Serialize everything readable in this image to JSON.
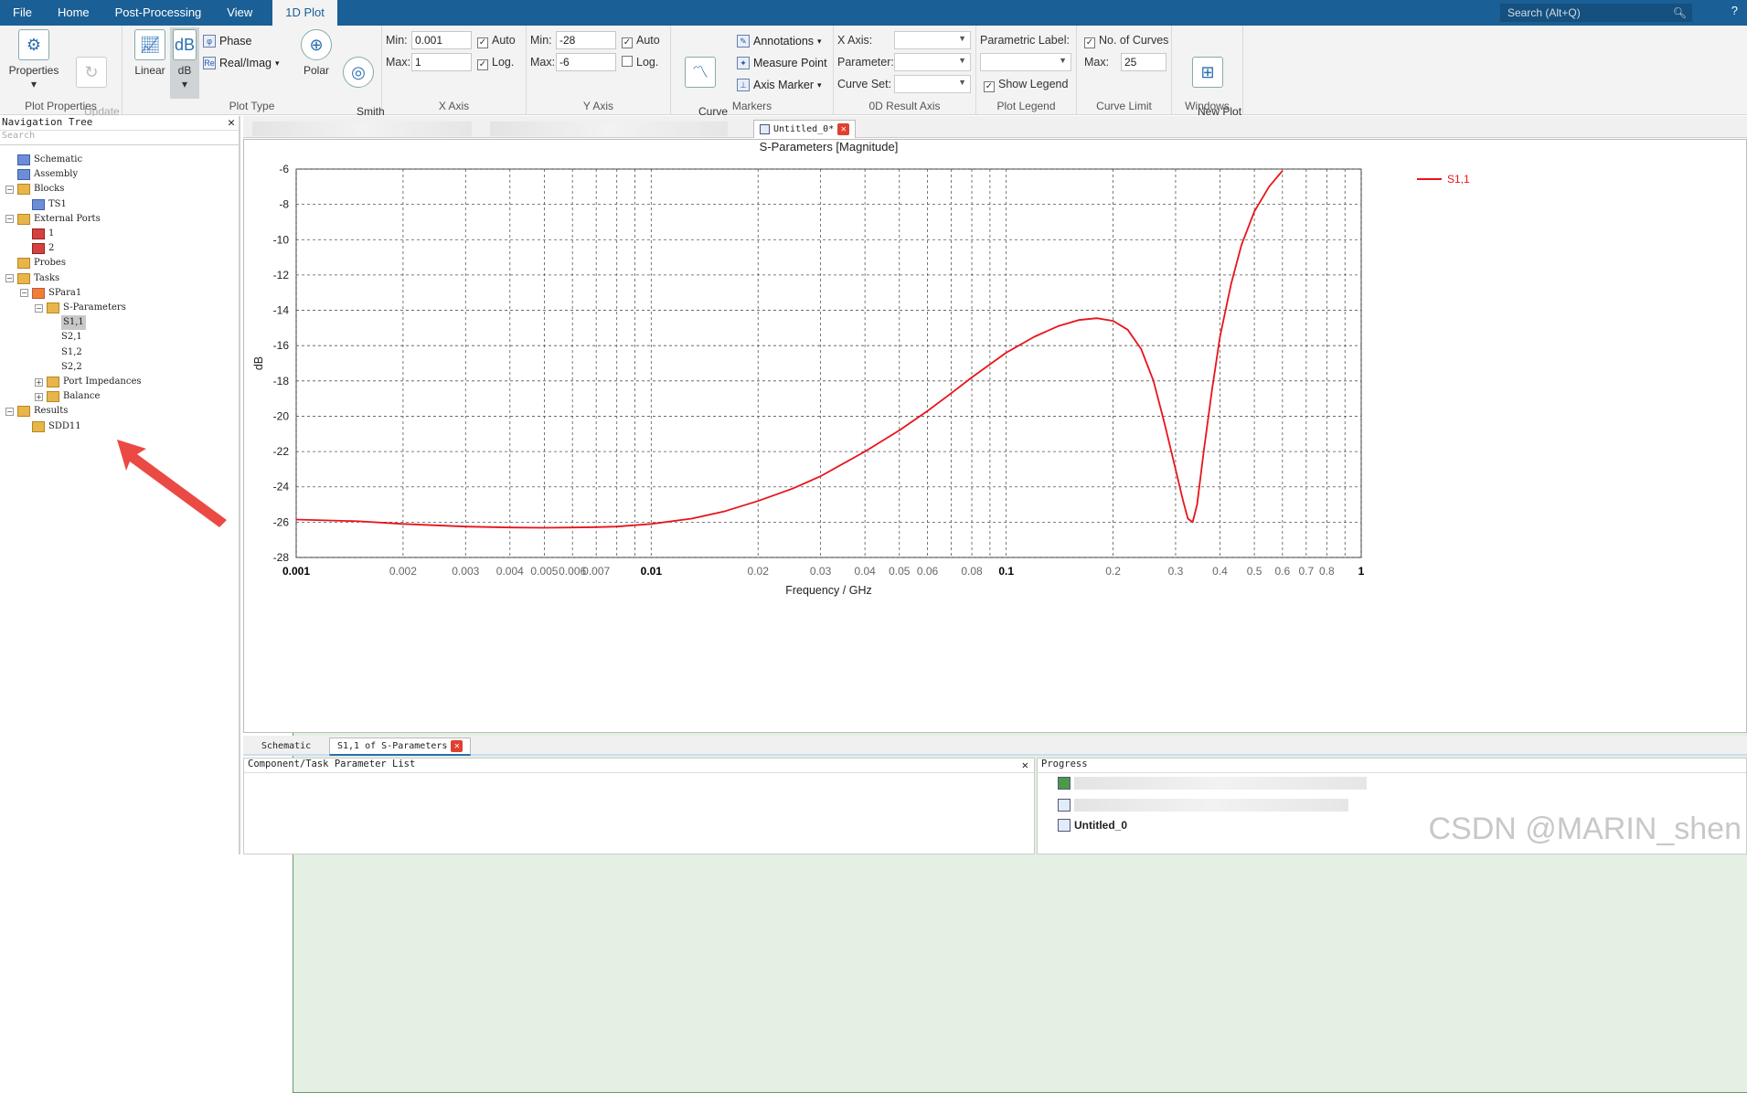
{
  "menu": {
    "items": [
      "File",
      "Home",
      "Post-Processing",
      "View",
      "1D Plot"
    ],
    "active": "1D Plot",
    "search_placeholder": "Search (Alt+Q)"
  },
  "ribbon": {
    "plot_properties": {
      "label": "Plot Properties",
      "properties": "Properties",
      "update": "Update\nResults"
    },
    "plot_type": {
      "label": "Plot Type",
      "linear": "Linear",
      "db": "dB",
      "phase": "Phase",
      "realimag": "Real/Imag",
      "polar": "Polar",
      "smith": "Smith\nChart"
    },
    "x_axis": {
      "label": "X Axis",
      "min_label": "Min:",
      "min": "0.001",
      "max_label": "Max:",
      "max": "1",
      "auto": "Auto",
      "auto_checked": true,
      "log": "Log.",
      "log_checked": true
    },
    "y_axis": {
      "label": "Y Axis",
      "min_label": "Min:",
      "min": "-28",
      "max_label": "Max:",
      "max": "-6",
      "auto": "Auto",
      "auto_checked": true,
      "log": "Log.",
      "log_checked": false
    },
    "markers": {
      "label": "Markers",
      "curve_markers": "Curve\nMarkers",
      "annotations": "Annotations",
      "measure_point": "Measure Point",
      "axis_marker": "Axis Marker"
    },
    "result0d": {
      "label": "0D Result Axis",
      "x_axis": "X Axis:",
      "parameter": "Parameter:",
      "curve_set": "Curve Set:"
    },
    "plot_legend": {
      "label": "Plot Legend",
      "parametric_label": "Parametric Label:",
      "show_legend": "Show Legend",
      "show_checked": true
    },
    "curve_limit": {
      "label": "Curve Limit",
      "no_curves": "No. of Curves",
      "no_checked": true,
      "max_label": "Max:",
      "max": "25"
    },
    "windows": {
      "label": "Windows",
      "new_plot": "New Plot\nWindow"
    }
  },
  "nav": {
    "title": "Navigation Tree",
    "search_placeholder": "Search",
    "items": [
      {
        "label": "Schematic",
        "icon": "schematic-icon",
        "level": 0
      },
      {
        "label": "Assembly",
        "icon": "assembly-icon",
        "level": 0
      },
      {
        "label": "Blocks",
        "icon": "folder-icon",
        "level": 0,
        "exp": "−"
      },
      {
        "label": "TS1",
        "icon": "block-icon",
        "level": 1
      },
      {
        "label": "External Ports",
        "icon": "folder-icon",
        "level": 0,
        "exp": "−"
      },
      {
        "label": "1",
        "icon": "port-icon",
        "level": 1
      },
      {
        "label": "2",
        "icon": "port-icon",
        "level": 1
      },
      {
        "label": "Probes",
        "icon": "folder-icon",
        "level": 0
      },
      {
        "label": "Tasks",
        "icon": "folder-icon",
        "level": 0,
        "exp": "−"
      },
      {
        "label": "SPara1",
        "icon": "task-icon",
        "level": 1,
        "exp": "−"
      },
      {
        "label": "S-Parameters",
        "icon": "folder-icon",
        "level": 2,
        "exp": "−"
      },
      {
        "label": "S1,1",
        "icon": "plot-icon",
        "level": 3,
        "selected": true
      },
      {
        "label": "S2,1",
        "icon": "plot-icon",
        "level": 3
      },
      {
        "label": "S1,2",
        "icon": "plot-icon",
        "level": 3
      },
      {
        "label": "S2,2",
        "icon": "plot-icon",
        "level": 3
      },
      {
        "label": "Port Impedances",
        "icon": "folder-icon",
        "level": 2,
        "exp": "+"
      },
      {
        "label": "Balance",
        "icon": "folder-icon",
        "level": 2,
        "exp": "+"
      },
      {
        "label": "Results",
        "icon": "folder-icon",
        "level": 0,
        "exp": "−"
      },
      {
        "label": "SDD11",
        "icon": "folder-icon",
        "level": 1
      }
    ]
  },
  "doc_tabs": {
    "active": "Untitled_0*"
  },
  "chart_data": {
    "type": "line",
    "title": "S-Parameters [Magnitude]",
    "xlabel": "Frequency / GHz",
    "ylabel": "dB",
    "xscale": "log",
    "xlim": [
      0.001,
      1
    ],
    "ylim": [
      -28,
      -6
    ],
    "grid": true,
    "legend": "top-right",
    "y_ticks": [
      -6,
      -8,
      -10,
      -12,
      -14,
      -16,
      -18,
      -20,
      -22,
      -24,
      -26,
      -28
    ],
    "x_ticks": [
      {
        "v": 0.001,
        "l": "0.001",
        "major": true
      },
      {
        "v": 0.002,
        "l": "0.002"
      },
      {
        "v": 0.003,
        "l": "0.003"
      },
      {
        "v": 0.004,
        "l": "0.004"
      },
      {
        "v": 0.005,
        "l": "0.005"
      },
      {
        "v": 0.006,
        "l": "0.006"
      },
      {
        "v": 0.007,
        "l": "0.007"
      },
      {
        "v": 0.008,
        "l": ""
      },
      {
        "v": 0.009,
        "l": ""
      },
      {
        "v": 0.01,
        "l": "0.01",
        "major": true
      },
      {
        "v": 0.02,
        "l": "0.02"
      },
      {
        "v": 0.03,
        "l": "0.03"
      },
      {
        "v": 0.04,
        "l": "0.04"
      },
      {
        "v": 0.05,
        "l": "0.05"
      },
      {
        "v": 0.06,
        "l": "0.06"
      },
      {
        "v": 0.07,
        "l": ""
      },
      {
        "v": 0.08,
        "l": "0.08"
      },
      {
        "v": 0.09,
        "l": ""
      },
      {
        "v": 0.1,
        "l": "0.1",
        "major": true
      },
      {
        "v": 0.2,
        "l": "0.2"
      },
      {
        "v": 0.3,
        "l": "0.3"
      },
      {
        "v": 0.4,
        "l": "0.4"
      },
      {
        "v": 0.5,
        "l": "0.5"
      },
      {
        "v": 0.6,
        "l": "0.6"
      },
      {
        "v": 0.7,
        "l": "0.7"
      },
      {
        "v": 0.8,
        "l": "0.8"
      },
      {
        "v": 0.9,
        "l": ""
      },
      {
        "v": 1,
        "l": "1",
        "major": true
      }
    ],
    "series": [
      {
        "name": "S1,1",
        "color": "#e8141a",
        "x": [
          0.001,
          0.0015,
          0.002,
          0.003,
          0.004,
          0.005,
          0.006,
          0.007,
          0.008,
          0.01,
          0.013,
          0.016,
          0.02,
          0.025,
          0.03,
          0.04,
          0.05,
          0.06,
          0.07,
          0.08,
          0.1,
          0.12,
          0.14,
          0.16,
          0.18,
          0.2,
          0.22,
          0.24,
          0.26,
          0.28,
          0.3,
          0.315,
          0.325,
          0.335,
          0.345,
          0.36,
          0.38,
          0.4,
          0.43,
          0.46,
          0.5,
          0.55,
          0.6
        ],
        "y": [
          -25.85,
          -25.95,
          -26.1,
          -26.25,
          -26.3,
          -26.32,
          -26.3,
          -26.28,
          -26.25,
          -26.1,
          -25.8,
          -25.4,
          -24.8,
          -24.1,
          -23.4,
          -22.0,
          -20.8,
          -19.7,
          -18.7,
          -17.8,
          -16.4,
          -15.5,
          -14.9,
          -14.55,
          -14.45,
          -14.6,
          -15.1,
          -16.2,
          -18.0,
          -20.5,
          -23.0,
          -24.8,
          -25.8,
          -26.0,
          -25.0,
          -22.0,
          -18.5,
          -15.5,
          -12.5,
          -10.3,
          -8.4,
          -7.0,
          -6.1
        ]
      }
    ]
  },
  "bottom_tabs": {
    "schematic": "Schematic",
    "active": "S1,1 of S-Parameters"
  },
  "panels": {
    "param_list": "Component/Task Parameter List",
    "progress": "Progress",
    "progress_item": "Untitled_0"
  },
  "watermark": "CSDN @MARIN_shen"
}
